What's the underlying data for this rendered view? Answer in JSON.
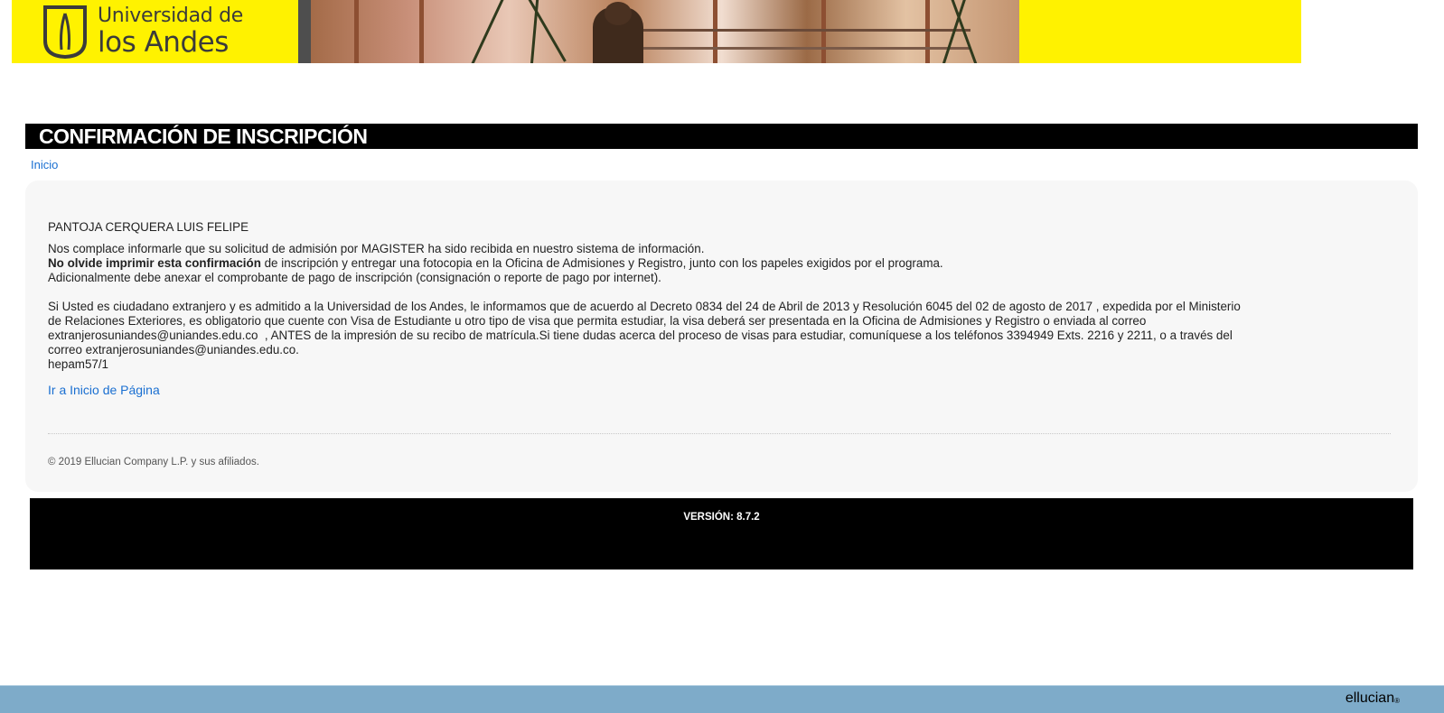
{
  "banner": {
    "logo_line1": "Universidad de",
    "logo_line2": "los Andes"
  },
  "page_title": "CONFIRMACIÓN DE INSCRIPCIÓN",
  "breadcrumb": "Inicio",
  "content": {
    "applicant_name": "PANTOJA CERQUERA LUIS FELIPE",
    "received_message": "Nos complace informarle que su solicitud de admisión por MAGISTER ha sido recibida en nuestro sistema de información.",
    "reminder_bold": "No olvide imprimir esta confirmación",
    "reminder_rest": " de inscripción y entregar una fotocopia en la Oficina de Admisiones y Registro, junto con los papeles exigidos por el programa.",
    "payment_note": "Adicionalmente debe anexar el comprobante de pago de inscripción (consignación o reporte de pago por internet).",
    "visa_line1": "Si Usted es ciudadano extranjero y es admitido a la Universidad de los Andes, le informamos que de acuerdo al Decreto 0834 del 24 de Abril de 2013 y Resolución 6045 del 02 de agosto de 2017 , expedida por el Ministerio",
    "visa_line2": "de Relaciones Exteriores, es obligatorio que cuente con Visa de Estudiante u otro tipo de visa que permita estudiar, la visa deberá ser presentada en la Oficina de Admisiones y Registro o enviada al correo",
    "visa_line3": "extranjerosuniandes@uniandes.edu.co  , ANTES de la impresión de su recibo de matrícula.Si tiene dudas acerca del proceso de visas para estudiar, comuníquese a los teléfonos 3394949 Exts. 2216 y 2211, o a través del",
    "visa_line4": "correo extranjerosuniandes@uniandes.edu.co.",
    "page_code": "hepam57/1",
    "home_link": "Ir a Inicio de Página",
    "copyright": "© 2019 Ellucian Company L.P. y sus afiliados."
  },
  "version": "VERSIÓN: 8.7.2",
  "footer": {
    "brand": "ellucian",
    "brand_mark": "®"
  }
}
